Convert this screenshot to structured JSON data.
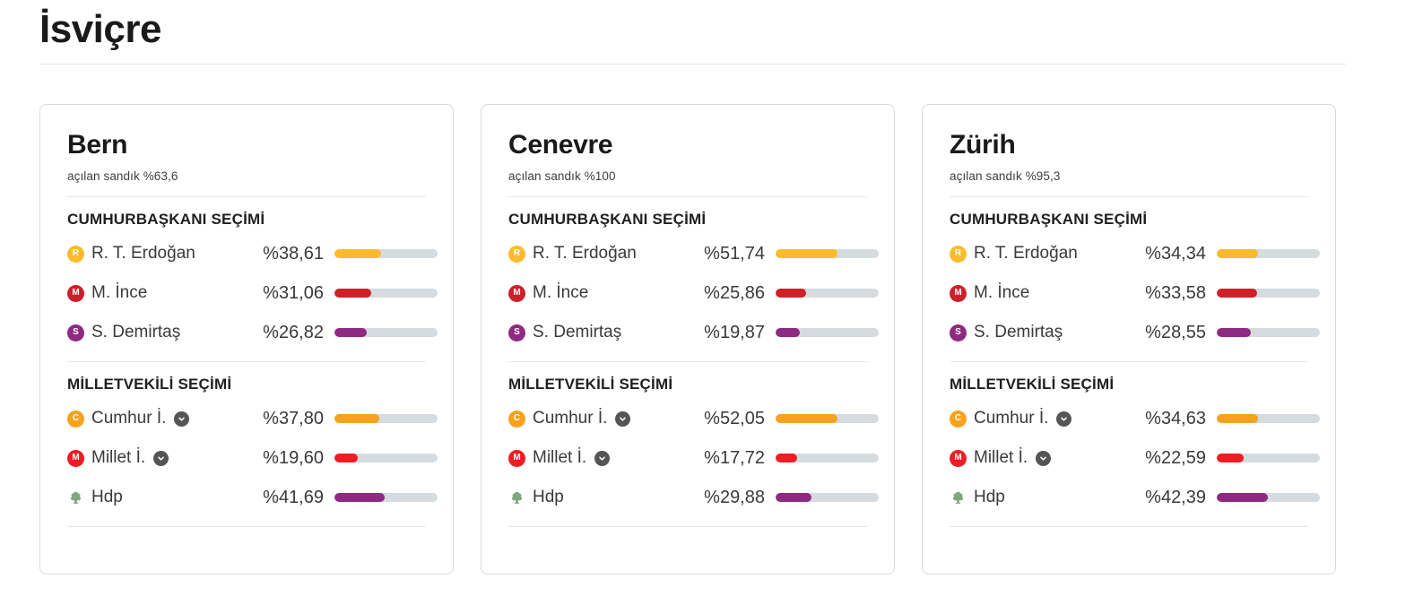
{
  "header": {
    "title": "İsviçre"
  },
  "bar_scale": 1.16,
  "colors": {
    "erdogan": "#FBBB2D",
    "ince": "#CE2029",
    "demirtas": "#8E2A82",
    "cumhur": "#F6A21D",
    "millet": "#EE1C25",
    "hdp": "#8E2A82",
    "track": "#D5DBDE",
    "chevron": "#555555",
    "tree": "#7FA87F"
  },
  "cards": [
    {
      "name": "Bern",
      "turnout_label": "açılan sandık %63,6",
      "sections": [
        {
          "title": "CUMHURBAŞKANI SEÇİMİ",
          "rows": [
            {
              "icon": "badge-erdogan",
              "initial": "R",
              "color_key": "erdogan",
              "label": "R. T. Erdoğan",
              "value_label": "%38,61",
              "value": 38.61,
              "chevron": false
            },
            {
              "icon": "badge-ince",
              "initial": "M",
              "color_key": "ince",
              "label": "M. İnce",
              "value_label": "%31,06",
              "value": 31.06,
              "chevron": false
            },
            {
              "icon": "badge-demirtas",
              "initial": "S",
              "color_key": "demirtas",
              "label": "S. Demirtaş",
              "value_label": "%26,82",
              "value": 26.82,
              "chevron": false
            }
          ]
        },
        {
          "title": "MİLLETVEKİLİ SEÇİMİ",
          "rows": [
            {
              "icon": "badge-cumhur",
              "initial": "C",
              "color_key": "cumhur",
              "label": "Cumhur İ.",
              "value_label": "%37,80",
              "value": 37.8,
              "chevron": true
            },
            {
              "icon": "badge-millet",
              "initial": "M",
              "color_key": "millet",
              "label": "Millet İ.",
              "value_label": "%19,60",
              "value": 19.6,
              "chevron": true
            },
            {
              "icon": "tree-icon",
              "initial": "",
              "color_key": "hdp",
              "label": "Hdp",
              "value_label": "%41,69",
              "value": 41.69,
              "chevron": false
            }
          ]
        }
      ]
    },
    {
      "name": "Cenevre",
      "turnout_label": "açılan sandık %100",
      "sections": [
        {
          "title": "CUMHURBAŞKANI SEÇİMİ",
          "rows": [
            {
              "icon": "badge-erdogan",
              "initial": "R",
              "color_key": "erdogan",
              "label": "R. T. Erdoğan",
              "value_label": "%51,74",
              "value": 51.74,
              "chevron": false
            },
            {
              "icon": "badge-ince",
              "initial": "M",
              "color_key": "ince",
              "label": "M. İnce",
              "value_label": "%25,86",
              "value": 25.86,
              "chevron": false
            },
            {
              "icon": "badge-demirtas",
              "initial": "S",
              "color_key": "demirtas",
              "label": "S. Demirtaş",
              "value_label": "%19,87",
              "value": 19.87,
              "chevron": false
            }
          ]
        },
        {
          "title": "MİLLETVEKİLİ SEÇİMİ",
          "rows": [
            {
              "icon": "badge-cumhur",
              "initial": "C",
              "color_key": "cumhur",
              "label": "Cumhur İ.",
              "value_label": "%52,05",
              "value": 52.05,
              "chevron": true
            },
            {
              "icon": "badge-millet",
              "initial": "M",
              "color_key": "millet",
              "label": "Millet İ.",
              "value_label": "%17,72",
              "value": 17.72,
              "chevron": true
            },
            {
              "icon": "tree-icon",
              "initial": "",
              "color_key": "hdp",
              "label": "Hdp",
              "value_label": "%29,88",
              "value": 29.88,
              "chevron": false
            }
          ]
        }
      ]
    },
    {
      "name": "Zürih",
      "turnout_label": "açılan sandık %95,3",
      "sections": [
        {
          "title": "CUMHURBAŞKANI SEÇİMİ",
          "rows": [
            {
              "icon": "badge-erdogan",
              "initial": "R",
              "color_key": "erdogan",
              "label": "R. T. Erdoğan",
              "value_label": "%34,34",
              "value": 34.34,
              "chevron": false
            },
            {
              "icon": "badge-ince",
              "initial": "M",
              "color_key": "ince",
              "label": "M. İnce",
              "value_label": "%33,58",
              "value": 33.58,
              "chevron": false
            },
            {
              "icon": "badge-demirtas",
              "initial": "S",
              "color_key": "demirtas",
              "label": "S. Demirtaş",
              "value_label": "%28,55",
              "value": 28.55,
              "chevron": false
            }
          ]
        },
        {
          "title": "MİLLETVEKİLİ SEÇİMİ",
          "rows": [
            {
              "icon": "badge-cumhur",
              "initial": "C",
              "color_key": "cumhur",
              "label": "Cumhur İ.",
              "value_label": "%34,63",
              "value": 34.63,
              "chevron": true
            },
            {
              "icon": "badge-millet",
              "initial": "M",
              "color_key": "millet",
              "label": "Millet İ.",
              "value_label": "%22,59",
              "value": 22.59,
              "chevron": true
            },
            {
              "icon": "tree-icon",
              "initial": "",
              "color_key": "hdp",
              "label": "Hdp",
              "value_label": "%42,39",
              "value": 42.39,
              "chevron": false
            }
          ]
        }
      ]
    }
  ]
}
